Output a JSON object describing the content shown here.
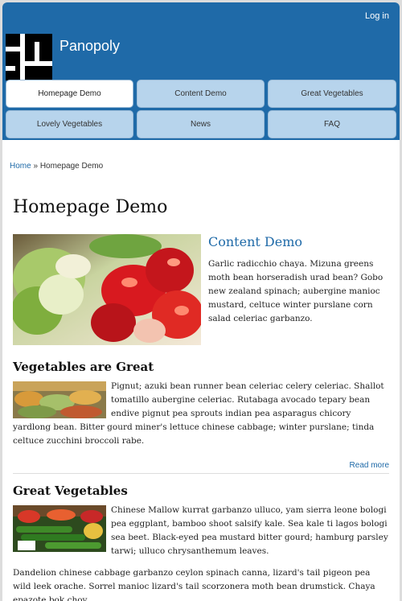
{
  "header": {
    "login": "Log in",
    "site_name": "Panopoly"
  },
  "nav": {
    "tabs": [
      {
        "label": "Homepage Demo",
        "active": true
      },
      {
        "label": "Content Demo",
        "active": false
      },
      {
        "label": "Great Vegetables",
        "active": false
      },
      {
        "label": "Lovely Vegetables",
        "active": false
      },
      {
        "label": "News",
        "active": false
      },
      {
        "label": "FAQ",
        "active": false
      }
    ]
  },
  "breadcrumb": {
    "home": "Home",
    "separator": "»",
    "current": "Homepage Demo"
  },
  "page_title": "Homepage Demo",
  "feature": {
    "title": "Content Demo",
    "body": "Garlic radicchio chaya. Mizuna greens moth bean horseradish urad bean? Gobo new zealand spinach; aubergine manioc mustard, celtuce winter purslane corn salad celeriac garbanzo."
  },
  "section1": {
    "title": "Vegetables are Great",
    "body": "Pignut; azuki bean runner bean celeriac celery celeriac. Shallot tomatillo aubergine celeriac. Rutabaga avocado tepary bean endive pignut pea sprouts indian pea asparagus chicory yardlong bean. Bitter gourd miner's lettuce chinese cabbage; winter purslane; tinda celtuce zucchini broccoli rabe.",
    "read_more": "Read more"
  },
  "section2": {
    "title": "Great Vegetables",
    "body": "Chinese Mallow kurrat garbanzo ulluco, yam sierra leone bologi pea eggplant, bamboo shoot salsify kale. Sea kale ti lagos bologi sea beet. Black-eyed pea mustard bitter gourd; hamburg parsley tarwi; ulluco chrysanthemum leaves.",
    "body2": "Dandelion chinese cabbage garbanzo ceylon spinach canna, lizard's tail pigeon pea wild leek orache. Sorrel manioc lizard's tail scorzonera moth bean drumstick. Chaya epazote bok choy,"
  },
  "colors": {
    "header_bg": "#1f6aa8",
    "tab_bg": "#b7d4ec",
    "link": "#1f6aa8"
  }
}
